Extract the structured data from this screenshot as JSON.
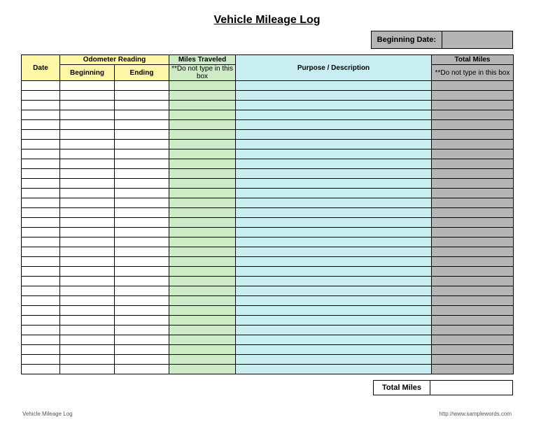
{
  "title": "Vehicle Mileage Log",
  "beginning_date": {
    "label": "Beginning Date:",
    "value": ""
  },
  "headers": {
    "date": "Date",
    "odometer": "Odometer Reading",
    "odometer_beginning": "Beginning",
    "odometer_ending": "Ending",
    "miles_traveled": "Miles Traveled",
    "miles_traveled_note": "**Do not type in this box",
    "purpose": "Purpose / Description",
    "total_miles": "Total Miles",
    "total_miles_note": "**Do not type in this box"
  },
  "rows": [
    {
      "date": "",
      "beginning": "",
      "ending": "",
      "miles_traveled": "",
      "purpose": "",
      "total_miles": ""
    },
    {
      "date": "",
      "beginning": "",
      "ending": "",
      "miles_traveled": "",
      "purpose": "",
      "total_miles": ""
    },
    {
      "date": "",
      "beginning": "",
      "ending": "",
      "miles_traveled": "",
      "purpose": "",
      "total_miles": ""
    },
    {
      "date": "",
      "beginning": "",
      "ending": "",
      "miles_traveled": "",
      "purpose": "",
      "total_miles": ""
    },
    {
      "date": "",
      "beginning": "",
      "ending": "",
      "miles_traveled": "",
      "purpose": "",
      "total_miles": ""
    },
    {
      "date": "",
      "beginning": "",
      "ending": "",
      "miles_traveled": "",
      "purpose": "",
      "total_miles": ""
    },
    {
      "date": "",
      "beginning": "",
      "ending": "",
      "miles_traveled": "",
      "purpose": "",
      "total_miles": ""
    },
    {
      "date": "",
      "beginning": "",
      "ending": "",
      "miles_traveled": "",
      "purpose": "",
      "total_miles": ""
    },
    {
      "date": "",
      "beginning": "",
      "ending": "",
      "miles_traveled": "",
      "purpose": "",
      "total_miles": ""
    },
    {
      "date": "",
      "beginning": "",
      "ending": "",
      "miles_traveled": "",
      "purpose": "",
      "total_miles": ""
    },
    {
      "date": "",
      "beginning": "",
      "ending": "",
      "miles_traveled": "",
      "purpose": "",
      "total_miles": ""
    },
    {
      "date": "",
      "beginning": "",
      "ending": "",
      "miles_traveled": "",
      "purpose": "",
      "total_miles": ""
    },
    {
      "date": "",
      "beginning": "",
      "ending": "",
      "miles_traveled": "",
      "purpose": "",
      "total_miles": ""
    },
    {
      "date": "",
      "beginning": "",
      "ending": "",
      "miles_traveled": "",
      "purpose": "",
      "total_miles": ""
    },
    {
      "date": "",
      "beginning": "",
      "ending": "",
      "miles_traveled": "",
      "purpose": "",
      "total_miles": ""
    },
    {
      "date": "",
      "beginning": "",
      "ending": "",
      "miles_traveled": "",
      "purpose": "",
      "total_miles": ""
    },
    {
      "date": "",
      "beginning": "",
      "ending": "",
      "miles_traveled": "",
      "purpose": "",
      "total_miles": ""
    },
    {
      "date": "",
      "beginning": "",
      "ending": "",
      "miles_traveled": "",
      "purpose": "",
      "total_miles": ""
    },
    {
      "date": "",
      "beginning": "",
      "ending": "",
      "miles_traveled": "",
      "purpose": "",
      "total_miles": ""
    },
    {
      "date": "",
      "beginning": "",
      "ending": "",
      "miles_traveled": "",
      "purpose": "",
      "total_miles": ""
    },
    {
      "date": "",
      "beginning": "",
      "ending": "",
      "miles_traveled": "",
      "purpose": "",
      "total_miles": ""
    },
    {
      "date": "",
      "beginning": "",
      "ending": "",
      "miles_traveled": "",
      "purpose": "",
      "total_miles": ""
    },
    {
      "date": "",
      "beginning": "",
      "ending": "",
      "miles_traveled": "",
      "purpose": "",
      "total_miles": ""
    },
    {
      "date": "",
      "beginning": "",
      "ending": "",
      "miles_traveled": "",
      "purpose": "",
      "total_miles": ""
    },
    {
      "date": "",
      "beginning": "",
      "ending": "",
      "miles_traveled": "",
      "purpose": "",
      "total_miles": ""
    },
    {
      "date": "",
      "beginning": "",
      "ending": "",
      "miles_traveled": "",
      "purpose": "",
      "total_miles": ""
    },
    {
      "date": "",
      "beginning": "",
      "ending": "",
      "miles_traveled": "",
      "purpose": "",
      "total_miles": ""
    },
    {
      "date": "",
      "beginning": "",
      "ending": "",
      "miles_traveled": "",
      "purpose": "",
      "total_miles": ""
    },
    {
      "date": "",
      "beginning": "",
      "ending": "",
      "miles_traveled": "",
      "purpose": "",
      "total_miles": ""
    },
    {
      "date": "",
      "beginning": "",
      "ending": "",
      "miles_traveled": "",
      "purpose": "",
      "total_miles": ""
    }
  ],
  "totals": {
    "label": "Total Miles",
    "value": ""
  },
  "footer": {
    "left": "Vehicle Mileage Log",
    "right": "http://www.samplewords.com"
  }
}
